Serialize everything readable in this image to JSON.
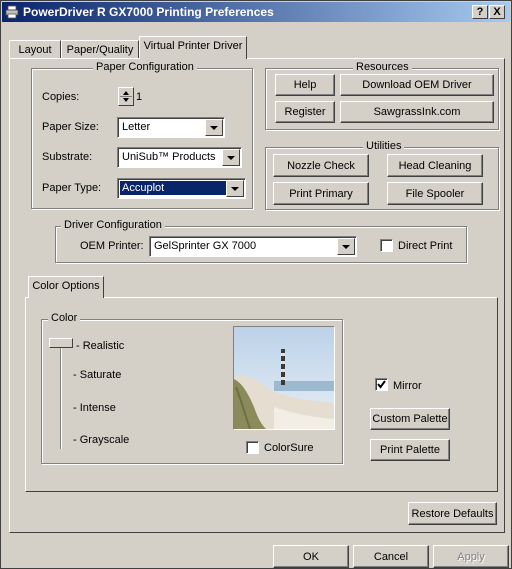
{
  "window": {
    "title": "PowerDriver R GX7000 Printing Preferences",
    "help_btn": "?",
    "close_btn": "X"
  },
  "tabs": [
    {
      "label": "Layout"
    },
    {
      "label": "Paper/Quality"
    },
    {
      "label": "Virtual Printer Driver"
    }
  ],
  "paper_config": {
    "legend": "Paper Configuration",
    "copies_label": "Copies:",
    "copies_value": "1",
    "paper_size_label": "Paper Size:",
    "paper_size_value": "Letter",
    "substrate_label": "Substrate:",
    "substrate_value": "UniSub™ Products",
    "paper_type_label": "Paper Type:",
    "paper_type_value": "Accuplot"
  },
  "resources": {
    "legend": "Resources",
    "help": "Help",
    "download": "Download OEM Driver",
    "register": "Register",
    "sawgrass": "SawgrassInk.com"
  },
  "utilities": {
    "legend": "Utilities",
    "nozzle": "Nozzle Check",
    "head": "Head Cleaning",
    "print_primary": "Print Primary",
    "spooler": "File Spooler"
  },
  "driver_config": {
    "legend": "Driver Configuration",
    "oem_label": "OEM Printer:",
    "oem_value": "GelSprinter GX 7000",
    "direct_print": "Direct Print",
    "direct_print_checked": false
  },
  "color_options": {
    "tab": "Color Options",
    "color_legend": "Color",
    "levels": [
      "Realistic",
      "Saturate",
      "Intense",
      "Grayscale"
    ],
    "selected_level": "Realistic",
    "colorsure": "ColorSure",
    "colorsure_checked": false,
    "mirror": "Mirror",
    "mirror_checked": true,
    "custom_palette": "Custom Palette",
    "print_palette": "Print Palette"
  },
  "restore_defaults": "Restore Defaults",
  "footer": {
    "ok": "OK",
    "cancel": "Cancel",
    "apply": "Apply"
  },
  "icons": {
    "title": "printer-icon",
    "spin": "spin-arrows-icon",
    "combo": "chevron-down-icon",
    "check": "checkmark-icon"
  }
}
